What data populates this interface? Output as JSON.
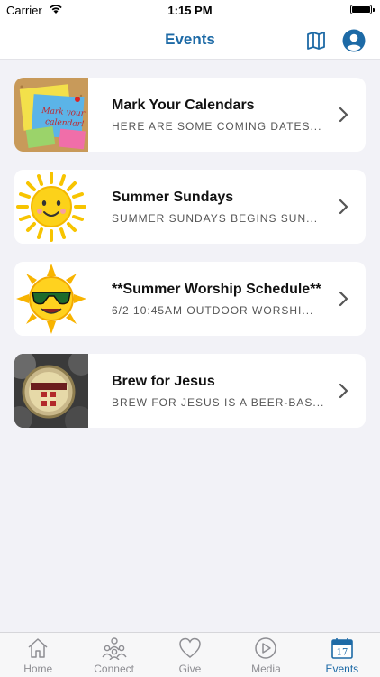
{
  "status_bar": {
    "carrier": "Carrier",
    "time": "1:15 PM"
  },
  "nav": {
    "title": "Events",
    "accent_color": "#1d6aa6",
    "right_icons": [
      "map-icon",
      "profile-icon"
    ]
  },
  "events": [
    {
      "title": "Mark Your Calendars",
      "subtitle": "HERE ARE SOME COMING DATES...",
      "thumb_icon": "sticky-notes-icon",
      "thumb_text": "Mark your calendar!"
    },
    {
      "title": "Summer Sundays",
      "subtitle": "SUMMER SUNDAYS BEGINS SUN...",
      "thumb_icon": "smiling-sun-icon"
    },
    {
      "title": "**Summer Worship Schedule**",
      "subtitle": "6/2 10:45AM OUTDOOR WORSHI...",
      "thumb_icon": "sun-sunglasses-icon"
    },
    {
      "title": "Brew for Jesus",
      "subtitle": "BREW FOR JESUS IS A BEER-BAS...",
      "thumb_icon": "bottle-caps-icon"
    }
  ],
  "tab_bar": {
    "tabs": [
      {
        "label": "Home",
        "icon": "home-icon"
      },
      {
        "label": "Connect",
        "icon": "people-icon"
      },
      {
        "label": "Give",
        "icon": "heart-icon"
      },
      {
        "label": "Media",
        "icon": "play-icon"
      },
      {
        "label": "Events",
        "icon": "calendar-icon",
        "badge_day": "17",
        "active": true
      }
    ]
  }
}
